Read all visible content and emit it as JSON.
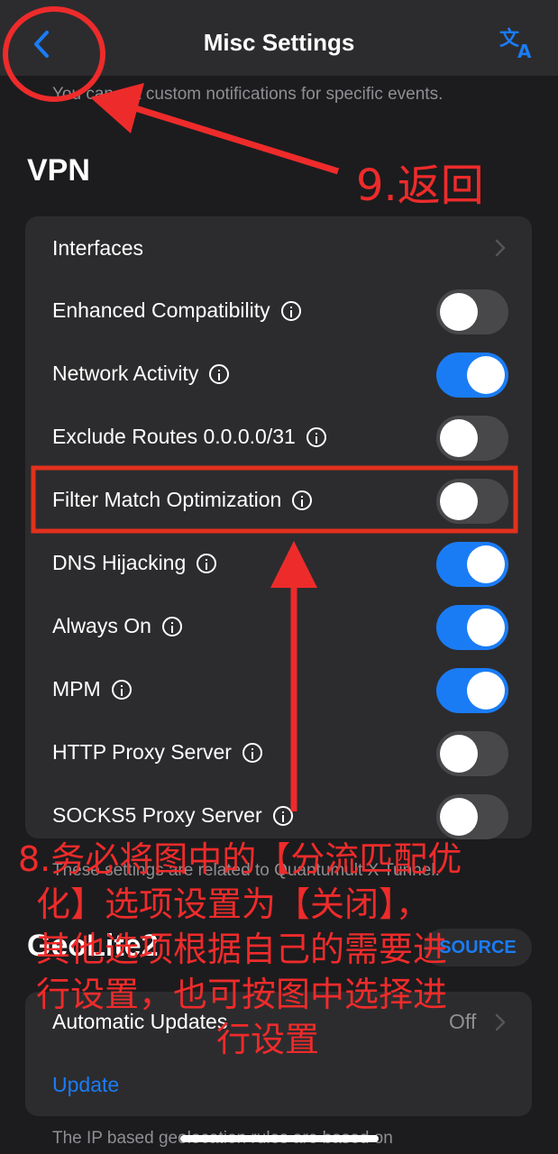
{
  "nav": {
    "title": "Misc Settings"
  },
  "notifications_note": "You can set custom notifications for specific events.",
  "vpn": {
    "title": "VPN",
    "rows": [
      {
        "label": "Interfaces",
        "type": "link"
      },
      {
        "label": "Enhanced Compatibility",
        "on": false
      },
      {
        "label": "Network Activity",
        "on": true
      },
      {
        "label": "Exclude Routes 0.0.0.0/31",
        "on": false
      },
      {
        "label": "Filter Match Optimization",
        "on": false
      },
      {
        "label": "DNS Hijacking",
        "on": true
      },
      {
        "label": "Always On",
        "on": true
      },
      {
        "label": "MPM",
        "on": true
      },
      {
        "label": "HTTP Proxy Server",
        "on": false
      },
      {
        "label": "SOCKS5 Proxy Server",
        "on": false
      }
    ],
    "footer": "These settings are related to Quantumult X Tunnel."
  },
  "geolite": {
    "title": "GeoLite2",
    "source_label": "SOURCE",
    "auto_updates_label": "Automatic Updates",
    "auto_updates_value": "Off",
    "update_label": "Update",
    "note": "The IP based geolocation rules are based on"
  },
  "annotations": {
    "back": "9.返回",
    "filter_line1": "8.务必将图中的【分流匹配优",
    "filter_line2": "化】选项设置为【关闭】，",
    "filter_line3": "其他选项根据自己的需要进",
    "filter_line4": "行设置，也可按图中选择进",
    "filter_line5": "行设置"
  },
  "colors": {
    "accent": "#1a7cf5",
    "annotation": "#ee2b2b",
    "toggle_off": "#48484a"
  }
}
